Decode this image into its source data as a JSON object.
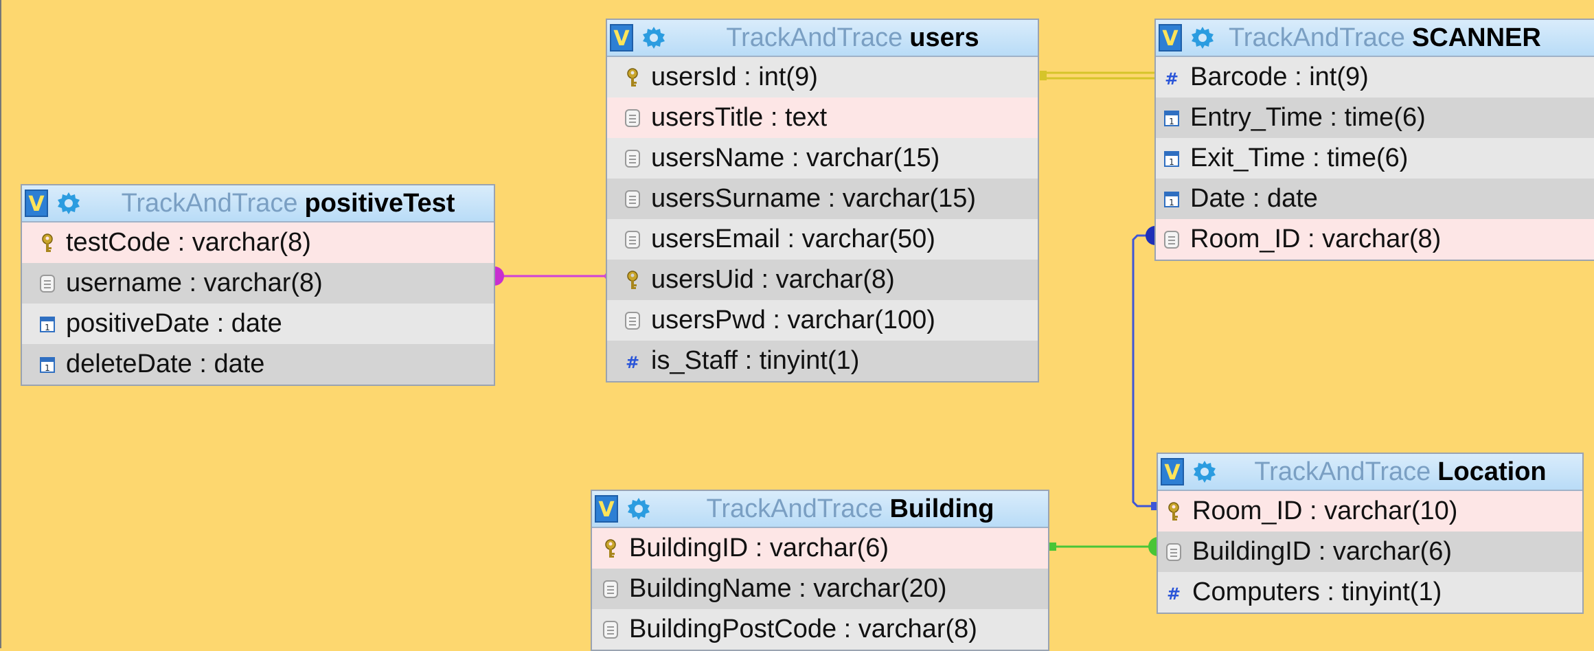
{
  "colors": {
    "background": "#fdd76f",
    "header": "#c3e1f8",
    "pk_row": "#fde6e6",
    "link_purple": "#d040d8",
    "link_yellow": "#d6c42a",
    "link_blue": "#3e55d6",
    "link_green": "#49c536"
  },
  "tables": [
    {
      "id": "positiveTest",
      "toggle": "V",
      "db": "TrackAndTrace",
      "name": "positiveTest",
      "columns": [
        {
          "text": "testCode : varchar(8)",
          "icon": "key-icon"
        },
        {
          "text": "username : varchar(8)",
          "icon": "text-column-icon"
        },
        {
          "text": "positiveDate : date",
          "icon": "date-column-icon"
        },
        {
          "text": "deleteDate : date",
          "icon": "date-column-icon"
        }
      ]
    },
    {
      "id": "users",
      "toggle": "V",
      "db": "TrackAndTrace",
      "name": "users",
      "columns": [
        {
          "text": "usersId : int(9)",
          "icon": "key-icon"
        },
        {
          "text": "usersTitle : text",
          "icon": "text-column-icon"
        },
        {
          "text": "usersName : varchar(15)",
          "icon": "text-column-icon"
        },
        {
          "text": "usersSurname : varchar(15)",
          "icon": "text-column-icon"
        },
        {
          "text": "usersEmail : varchar(50)",
          "icon": "text-column-icon"
        },
        {
          "text": "usersUid : varchar(8)",
          "icon": "key-icon"
        },
        {
          "text": "usersPwd : varchar(100)",
          "icon": "text-column-icon"
        },
        {
          "text": "is_Staff : tinyint(1)",
          "icon": "number-column-icon"
        }
      ]
    },
    {
      "id": "scanner",
      "toggle": "V",
      "db": "TrackAndTrace",
      "name": "SCANNER",
      "columns": [
        {
          "text": "Barcode : int(9)",
          "icon": "number-column-icon"
        },
        {
          "text": "Entry_Time : time(6)",
          "icon": "date-column-icon"
        },
        {
          "text": "Exit_Time : time(6)",
          "icon": "date-column-icon"
        },
        {
          "text": "Date : date",
          "icon": "date-column-icon"
        },
        {
          "text": "Room_ID : varchar(8)",
          "icon": "text-column-icon"
        }
      ]
    },
    {
      "id": "building",
      "toggle": "V",
      "db": "TrackAndTrace",
      "name": "Building",
      "columns": [
        {
          "text": "BuildingID : varchar(6)",
          "icon": "key-icon"
        },
        {
          "text": "BuildingName : varchar(20)",
          "icon": "text-column-icon"
        },
        {
          "text": "BuildingPostCode : varchar(8)",
          "icon": "text-column-icon"
        }
      ]
    },
    {
      "id": "location",
      "toggle": "V",
      "db": "TrackAndTrace",
      "name": "Location",
      "columns": [
        {
          "text": "Room_ID : varchar(10)",
          "icon": "key-icon"
        },
        {
          "text": "BuildingID : varchar(6)",
          "icon": "text-column-icon"
        },
        {
          "text": "Computers : tinyint(1)",
          "icon": "number-column-icon"
        }
      ]
    }
  ],
  "relations": [
    {
      "from": "positiveTest.username",
      "to": "users",
      "color": "link_purple"
    },
    {
      "from": "users.usersId",
      "to": "scanner.Barcode",
      "color": "link_yellow"
    },
    {
      "from": "scanner.Room_ID",
      "to": "location.Room_ID",
      "color": "link_blue"
    },
    {
      "from": "building.BuildingID",
      "to": "location.BuildingID",
      "color": "link_green"
    }
  ]
}
